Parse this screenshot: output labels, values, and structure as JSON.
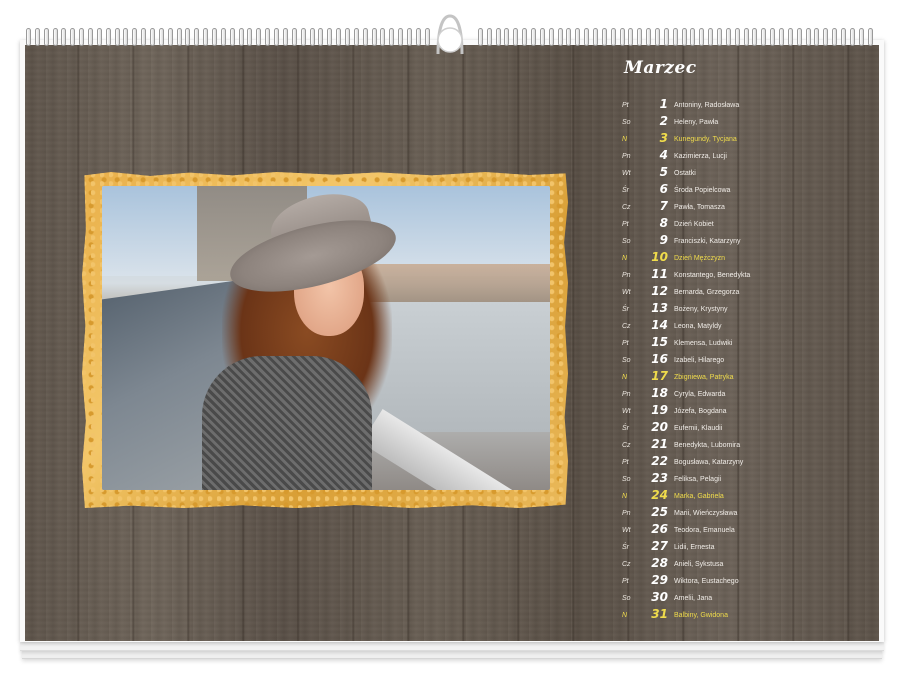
{
  "calendar": {
    "month": "Marzec",
    "days": [
      {
        "dow": "Pt",
        "num": "1",
        "names": "Antoniny, Radosława",
        "holiday": false
      },
      {
        "dow": "So",
        "num": "2",
        "names": "Heleny, Pawła",
        "holiday": false
      },
      {
        "dow": "N",
        "num": "3",
        "names": "Kunegundy, Tycjana",
        "holiday": true
      },
      {
        "dow": "Pn",
        "num": "4",
        "names": "Kazimierza, Lucji",
        "holiday": false
      },
      {
        "dow": "Wt",
        "num": "5",
        "names": "Ostatki",
        "holiday": false
      },
      {
        "dow": "Śr",
        "num": "6",
        "names": "Środa Popielcowa",
        "holiday": false
      },
      {
        "dow": "Cz",
        "num": "7",
        "names": "Pawła, Tomasza",
        "holiday": false
      },
      {
        "dow": "Pt",
        "num": "8",
        "names": "Dzień Kobiet",
        "holiday": false
      },
      {
        "dow": "So",
        "num": "9",
        "names": "Franciszki, Katarzyny",
        "holiday": false
      },
      {
        "dow": "N",
        "num": "10",
        "names": "Dzień Mężczyzn",
        "holiday": true
      },
      {
        "dow": "Pn",
        "num": "11",
        "names": "Konstantego, Benedykta",
        "holiday": false
      },
      {
        "dow": "Wt",
        "num": "12",
        "names": "Bernarda, Grzegorza",
        "holiday": false
      },
      {
        "dow": "Śr",
        "num": "13",
        "names": "Bożeny, Krystyny",
        "holiday": false
      },
      {
        "dow": "Cz",
        "num": "14",
        "names": "Leona, Matyldy",
        "holiday": false
      },
      {
        "dow": "Pt",
        "num": "15",
        "names": "Klemensa, Ludwiki",
        "holiday": false
      },
      {
        "dow": "So",
        "num": "16",
        "names": "Izabeli, Hilarego",
        "holiday": false
      },
      {
        "dow": "N",
        "num": "17",
        "names": "Zbigniewa, Patryka",
        "holiday": true
      },
      {
        "dow": "Pn",
        "num": "18",
        "names": "Cyryla, Edwarda",
        "holiday": false
      },
      {
        "dow": "Wt",
        "num": "19",
        "names": "Józefa, Bogdana",
        "holiday": false
      },
      {
        "dow": "Śr",
        "num": "20",
        "names": "Eufemii, Klaudii",
        "holiday": false
      },
      {
        "dow": "Cz",
        "num": "21",
        "names": "Benedykta, Lubomira",
        "holiday": false
      },
      {
        "dow": "Pt",
        "num": "22",
        "names": "Bogusława, Katarzyny",
        "holiday": false
      },
      {
        "dow": "So",
        "num": "23",
        "names": "Feliksa, Pelagii",
        "holiday": false
      },
      {
        "dow": "N",
        "num": "24",
        "names": "Marka, Gabriela",
        "holiday": true
      },
      {
        "dow": "Pn",
        "num": "25",
        "names": "Marii, Wieńczysława",
        "holiday": false
      },
      {
        "dow": "Wt",
        "num": "26",
        "names": "Teodora, Emanuela",
        "holiday": false
      },
      {
        "dow": "Śr",
        "num": "27",
        "names": "Lidii, Ernesta",
        "holiday": false
      },
      {
        "dow": "Cz",
        "num": "28",
        "names": "Anieli, Sykstusa",
        "holiday": false
      },
      {
        "dow": "Pt",
        "num": "29",
        "names": "Wiktora, Eustachego",
        "holiday": false
      },
      {
        "dow": "So",
        "num": "30",
        "names": "Amelii, Jana",
        "holiday": false
      },
      {
        "dow": "N",
        "num": "31",
        "names": "Balbiny, Gwidona",
        "holiday": true
      }
    ]
  },
  "colors": {
    "holiday": "#f0dc4c",
    "frame_gold": "#e9b04a",
    "wood": "#635a4f"
  },
  "photo": {
    "icon": "photo-woman-in-hat"
  }
}
